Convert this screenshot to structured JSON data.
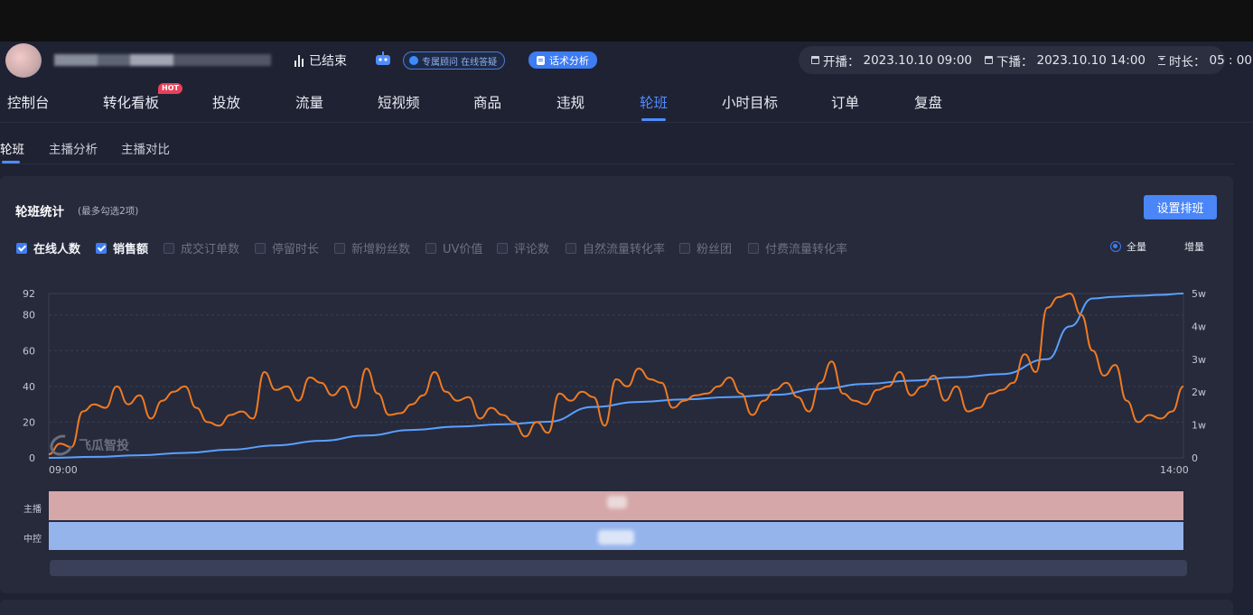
{
  "header": {
    "status": "已结束",
    "consult_label": "专属顾问 在线答疑",
    "speech_button": "话术分析",
    "start_label": "开播：",
    "start_time": "2023.10.10 09:00",
    "end_label": "下播：",
    "end_time": "2023.10.10 14:00",
    "duration_label": "时长：",
    "duration": "05 : 00"
  },
  "nav": {
    "items": [
      "控制台",
      "转化看板",
      "投放",
      "流量",
      "短视频",
      "商品",
      "违规",
      "轮班",
      "小时目标",
      "订单",
      "复盘"
    ],
    "active": "轮班",
    "hot_badge": "HOT"
  },
  "subnav": {
    "items": [
      "轮班",
      "主播分析",
      "主播对比"
    ],
    "active": "轮班"
  },
  "card": {
    "title": "轮班统计",
    "hint": "(最多勾选2项)",
    "set_button": "设置排班",
    "metrics": [
      {
        "label": "在线人数",
        "checked": true
      },
      {
        "label": "销售额",
        "checked": true
      },
      {
        "label": "成交订单数",
        "checked": false
      },
      {
        "label": "停留时长",
        "checked": false
      },
      {
        "label": "新增粉丝数",
        "checked": false
      },
      {
        "label": "UV价值",
        "checked": false
      },
      {
        "label": "评论数",
        "checked": false
      },
      {
        "label": "自然流量转化率",
        "checked": false
      },
      {
        "label": "粉丝团",
        "checked": false
      },
      {
        "label": "付费流量转化率",
        "checked": false
      }
    ],
    "mode": {
      "full": "全量",
      "incremental": "增量",
      "selected": "全量"
    },
    "rows": {
      "host": "主播",
      "control": "中控"
    },
    "watermark": "飞瓜智投"
  },
  "colors": {
    "accent": "#4f8cff",
    "online_line": "#f07a22",
    "sales_line": "#5aa0ff",
    "host_band": "#d6a7a9",
    "control_band": "#95b4ec",
    "hot": "#e8415a"
  },
  "icons": [
    "bar-chart-icon",
    "robot-icon",
    "calendar-icon",
    "hourglass-icon",
    "document-icon",
    "checkbox-icon",
    "radio-icon",
    "logo-icon"
  ],
  "chart_data": {
    "type": "line",
    "x_start": "09:00",
    "x_end": "14:00",
    "x_range_minutes": [
      0,
      300
    ],
    "left_axis": {
      "ticks": [
        "0",
        "20",
        "40",
        "60",
        "80",
        "92"
      ],
      "range": [
        0,
        92
      ]
    },
    "right_axis": {
      "ticks": [
        "0",
        "1w",
        "2w",
        "3w",
        "4w",
        "5w"
      ],
      "range": [
        0,
        50000
      ]
    },
    "grid": true,
    "series": [
      {
        "name": "在线人数",
        "axis": "left",
        "x": [
          0,
          3,
          6,
          9,
          12,
          15,
          18,
          21,
          24,
          27,
          30,
          33,
          36,
          39,
          42,
          45,
          48,
          51,
          54,
          57,
          60,
          63,
          66,
          69,
          72,
          75,
          78,
          81,
          84,
          87,
          90,
          93,
          96,
          99,
          102,
          105,
          108,
          111,
          114,
          117,
          120,
          123,
          126,
          129,
          132,
          135,
          138,
          141,
          144,
          147,
          150,
          153,
          156,
          159,
          162,
          165,
          168,
          171,
          174,
          177,
          180,
          183,
          186,
          189,
          192,
          195,
          198,
          201,
          204,
          207,
          210,
          213,
          216,
          219,
          222,
          225,
          228,
          231,
          234,
          237,
          240,
          243,
          246,
          249,
          252,
          255,
          258,
          261,
          264,
          267,
          270,
          273,
          276,
          279,
          282,
          285,
          288,
          291,
          294,
          297,
          300
        ],
        "values": [
          2,
          8,
          6,
          26,
          30,
          28,
          40,
          30,
          35,
          22,
          32,
          37,
          40,
          28,
          20,
          18,
          24,
          26,
          22,
          48,
          38,
          40,
          32,
          45,
          42,
          35,
          40,
          28,
          50,
          36,
          24,
          25,
          30,
          35,
          48,
          37,
          32,
          34,
          22,
          28,
          24,
          20,
          12,
          20,
          14,
          36,
          32,
          37,
          34,
          18,
          44,
          40,
          50,
          44,
          42,
          28,
          32,
          35,
          36,
          40,
          45,
          36,
          24,
          32,
          38,
          42,
          34,
          26,
          42,
          54,
          36,
          32,
          30,
          38,
          40,
          48,
          35,
          40,
          46,
          32,
          40,
          26,
          28,
          36,
          38,
          42,
          58,
          48,
          84,
          90,
          92,
          80,
          60,
          46,
          52,
          32,
          20,
          24,
          22,
          26,
          40
        ]
      },
      {
        "name": "销售额",
        "axis": "right",
        "x": [
          0,
          12,
          24,
          36,
          48,
          60,
          72,
          84,
          96,
          108,
          120,
          132,
          144,
          156,
          168,
          180,
          192,
          204,
          216,
          228,
          240,
          252,
          264,
          270,
          276,
          282,
          288,
          294,
          300
        ],
        "values": [
          0,
          300,
          800,
          1500,
          2500,
          3800,
          5200,
          6800,
          8500,
          9500,
          10200,
          11000,
          15500,
          17000,
          17800,
          18500,
          19200,
          21000,
          22500,
          23500,
          24500,
          25500,
          30000,
          40000,
          48500,
          49000,
          49300,
          49600,
          50000
        ]
      }
    ]
  }
}
